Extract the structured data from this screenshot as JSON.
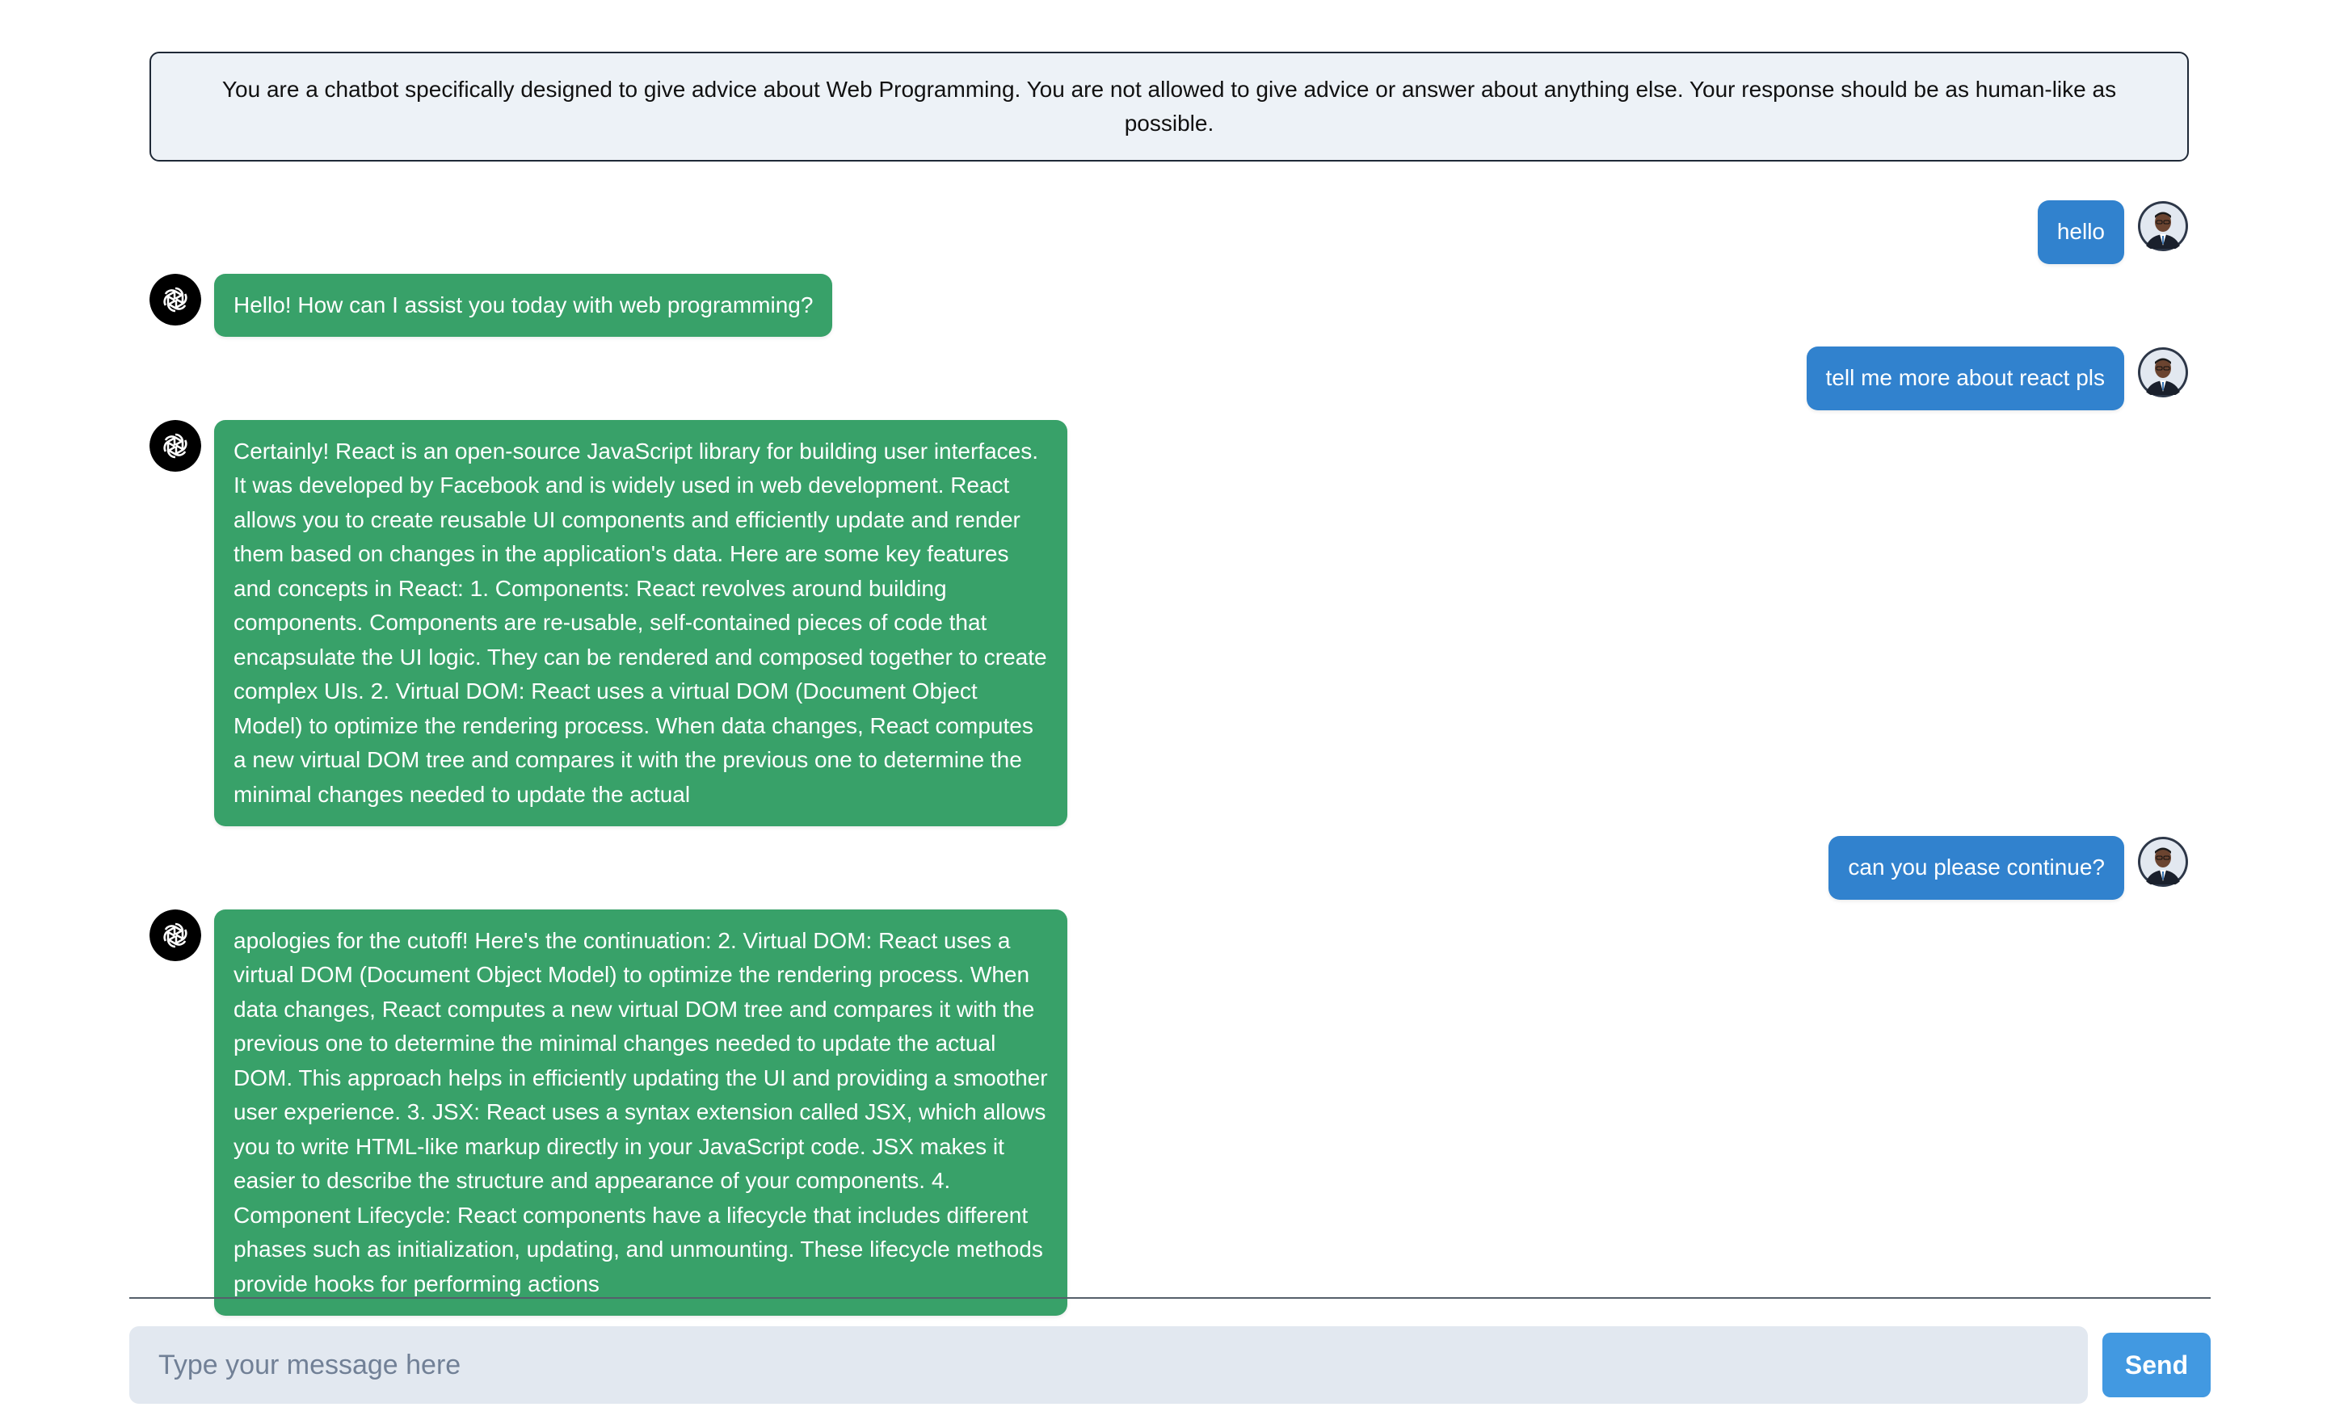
{
  "system_prompt": "You are a chatbot specifically designed to give advice about Web Programming. You are not allowed to give advice or answer about anything else. Your response should be as human-like as possible.",
  "messages": [
    {
      "role": "user",
      "text": "hello"
    },
    {
      "role": "bot",
      "text": "Hello! How can I assist you today with web programming?"
    },
    {
      "role": "user",
      "text": "tell me more about react pls"
    },
    {
      "role": "bot",
      "text": "Certainly! React is an open-source JavaScript library for building user interfaces. It was developed by Facebook and is widely used in web development. React allows you to create reusable UI components and efficiently update and render them based on changes in the application's data. Here are some key features and concepts in React: 1. Components: React revolves around building components. Components are re-usable, self-contained pieces of code that encapsulate the UI logic. They can be rendered and composed together to create complex UIs. 2. Virtual DOM: React uses a virtual DOM (Document Object Model) to optimize the rendering process. When data changes, React computes a new virtual DOM tree and compares it with the previous one to determine the minimal changes needed to update the actual"
    },
    {
      "role": "user",
      "text": "can you please continue?"
    },
    {
      "role": "bot",
      "text": "apologies for the cutoff! Here's the continuation: 2. Virtual DOM: React uses a virtual DOM (Document Object Model) to optimize the rendering process. When data changes, React computes a new virtual DOM tree and compares it with the previous one to determine the minimal changes needed to update the actual DOM. This approach helps in efficiently updating the UI and providing a smoother user experience. 3. JSX: React uses a syntax extension called JSX, which allows you to write HTML-like markup directly in your JavaScript code. JSX makes it easier to describe the structure and appearance of your components. 4. Component Lifecycle: React components have a lifecycle that includes different phases such as initialization, updating, and unmounting. These lifecycle methods provide hooks for performing actions"
    }
  ],
  "input": {
    "placeholder": "Type your message here",
    "value": ""
  },
  "send_label": "Send",
  "icons": {
    "bot_avatar": "openai-logo-icon",
    "user_avatar": "user-photo-avatar"
  },
  "colors": {
    "user_bubble": "#3182ce",
    "bot_bubble": "#38a169",
    "send_button": "#4299e1",
    "input_bg": "#e2e8f0",
    "system_bg": "#edf2f7"
  }
}
